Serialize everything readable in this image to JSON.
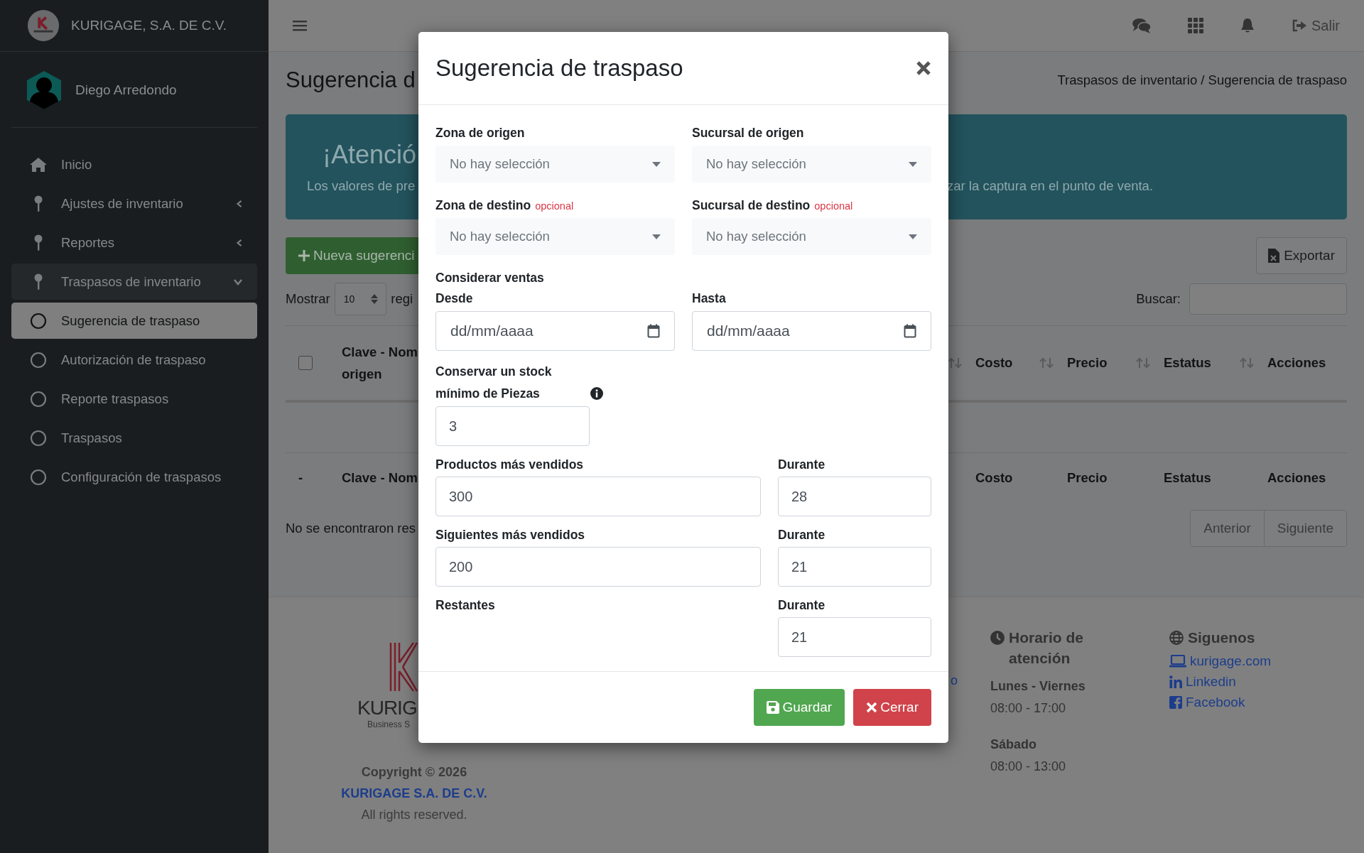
{
  "sidebar": {
    "brand": "KURIGAGE, S.A. DE C.V.",
    "user": "Diego Arredondo",
    "home": {
      "label": "Inicio"
    },
    "groups": [
      {
        "label": "Ajustes de inventario",
        "expanded": false
      },
      {
        "label": "Reportes",
        "expanded": false
      },
      {
        "label": "Traspasos de inventario",
        "expanded": true,
        "children": [
          {
            "label": "Sugerencia de traspaso",
            "selected": true
          },
          {
            "label": "Autorización de traspaso",
            "selected": false
          },
          {
            "label": "Reporte traspasos",
            "selected": false
          },
          {
            "label": "Traspasos",
            "selected": false
          },
          {
            "label": "Configuración de traspasos",
            "selected": false
          }
        ]
      }
    ]
  },
  "topbar": {
    "logout": "Salir"
  },
  "page": {
    "title": "Sugerencia d",
    "breadcrumb": "Traspasos de inventario / Sugerencia de traspaso",
    "alert": {
      "title": "¡Atenció",
      "text_left": "Los valores de pre",
      "text_right": "zar la captura en el punto de venta."
    },
    "new_button": "Nueva sugerenci",
    "export_button": "Exportar",
    "length": {
      "label": "Mostrar",
      "value": "10",
      "suffix": "regi"
    },
    "search": {
      "label": "Buscar:"
    },
    "table": {
      "select_all": {
        "checked": false
      },
      "columns": [
        {
          "label": "Clave - Nom\norigen"
        },
        {
          "label": "Costo"
        },
        {
          "label": "Precio"
        },
        {
          "label": "Estatus"
        },
        {
          "label": "Acciones"
        }
      ],
      "footer_columns": [
        "-",
        "Clave - Nom",
        "Costo",
        "Precio",
        "Estatus",
        "Acciones"
      ],
      "empty": "No se encontraron res",
      "pager": [
        "Anterior",
        "Siguiente"
      ]
    }
  },
  "footer": {
    "logo_text": "KURIG",
    "logo_sub": "Business S",
    "copyright": "Copyright © 2026",
    "company": "KURIGAGE S.A. DE C.V.",
    "rights": "All rights reserved.",
    "link_fragment": "o",
    "hours": {
      "title": "Horario de atención",
      "entries": [
        {
          "days": "Lunes - Viernes",
          "time": "08:00 - 17:00"
        },
        {
          "days": "Sábado",
          "time": "08:00 - 13:00"
        }
      ]
    },
    "social": {
      "title": "Siguenos",
      "links": [
        {
          "label": "kurigage.com",
          "kind": "web"
        },
        {
          "label": "Linkedin",
          "kind": "linkedin"
        },
        {
          "label": "Facebook",
          "kind": "facebook"
        }
      ]
    }
  },
  "modal": {
    "title": "Sugerencia de traspaso",
    "selects": [
      {
        "label": "Zona de origen",
        "placeholder": "No hay selección"
      },
      {
        "label": "Sucursal de origen",
        "placeholder": "No hay selección"
      },
      {
        "label": "Zona de destino",
        "note": "opcional",
        "placeholder": "No hay selección"
      },
      {
        "label": "Sucursal de destino",
        "note": "opcional",
        "placeholder": "No hay selección"
      }
    ],
    "section": "Considerar ventas",
    "dates": [
      {
        "label": "Desde",
        "placeholder": "dd/mm/aaaa"
      },
      {
        "label": "Hasta",
        "placeholder": "dd/mm/aaaa"
      }
    ],
    "stock": {
      "label": "Conservar un stock mínimo de Piezas",
      "value": "3"
    },
    "tiers": [
      {
        "label": "Productos más vendidos",
        "value": "300",
        "during_label": "Durante",
        "during_value": "28"
      },
      {
        "label": "Siguientes más vendidos",
        "value": "200",
        "during_label": "Durante",
        "during_value": "21"
      },
      {
        "label": "Restantes",
        "during_label": "Durante",
        "during_value": "21"
      }
    ],
    "buttons": [
      {
        "label": "Guardar",
        "kind": "save"
      },
      {
        "label": "Cerrar",
        "kind": "close"
      }
    ]
  }
}
